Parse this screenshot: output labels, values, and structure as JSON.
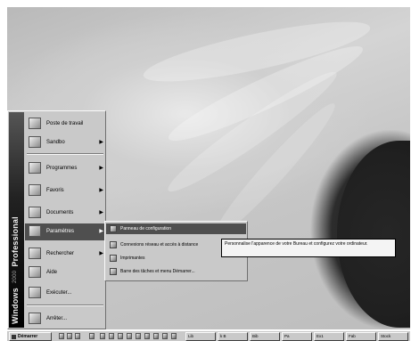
{
  "start_menu": {
    "banner_main": "Windows",
    "banner_sub": "2000",
    "banner_edition": "Professional",
    "items": [
      {
        "label": "Poste de travail",
        "icon": "computer-icon",
        "has_submenu": false
      },
      {
        "label": "Sandbo",
        "icon": "sandbox-icon",
        "has_submenu": true
      },
      {
        "label": "Programmes",
        "icon": "programs-icon",
        "has_submenu": true
      },
      {
        "label": "Favoris",
        "icon": "favorites-icon",
        "has_submenu": true
      },
      {
        "label": "Documents",
        "icon": "documents-icon",
        "has_submenu": true
      },
      {
        "label": "Paramètres",
        "icon": "settings-icon",
        "has_submenu": true
      },
      {
        "label": "Rechercher",
        "icon": "search-icon",
        "has_submenu": true
      },
      {
        "label": "Aide",
        "icon": "help-icon",
        "has_submenu": false
      },
      {
        "label": "Exécuter...",
        "icon": "run-icon",
        "has_submenu": false
      },
      {
        "label": "Arrêter...",
        "icon": "shutdown-icon",
        "has_submenu": false
      }
    ],
    "active_item": "Paramètres"
  },
  "settings_submenu": {
    "items": [
      {
        "label": "Panneau de configuration",
        "icon": "control-panel-icon"
      },
      {
        "label": "Connexions réseau et accès à distance",
        "icon": "network-icon"
      },
      {
        "label": "Imprimantes",
        "icon": "printer-icon"
      },
      {
        "label": "Barre des tâches et menu Démarrer...",
        "icon": "taskbar-icon"
      }
    ],
    "active_item": "Panneau de configuration"
  },
  "tooltip": {
    "text": "Personnalise l'apparence de votre Bureau et configurez votre ordinateur."
  },
  "taskbar": {
    "start_label": "Démarrer",
    "tasks": [
      "Lib",
      "k B",
      "Bib",
      "Pa",
      "Ex1",
      "Fab",
      "Stock"
    ]
  }
}
